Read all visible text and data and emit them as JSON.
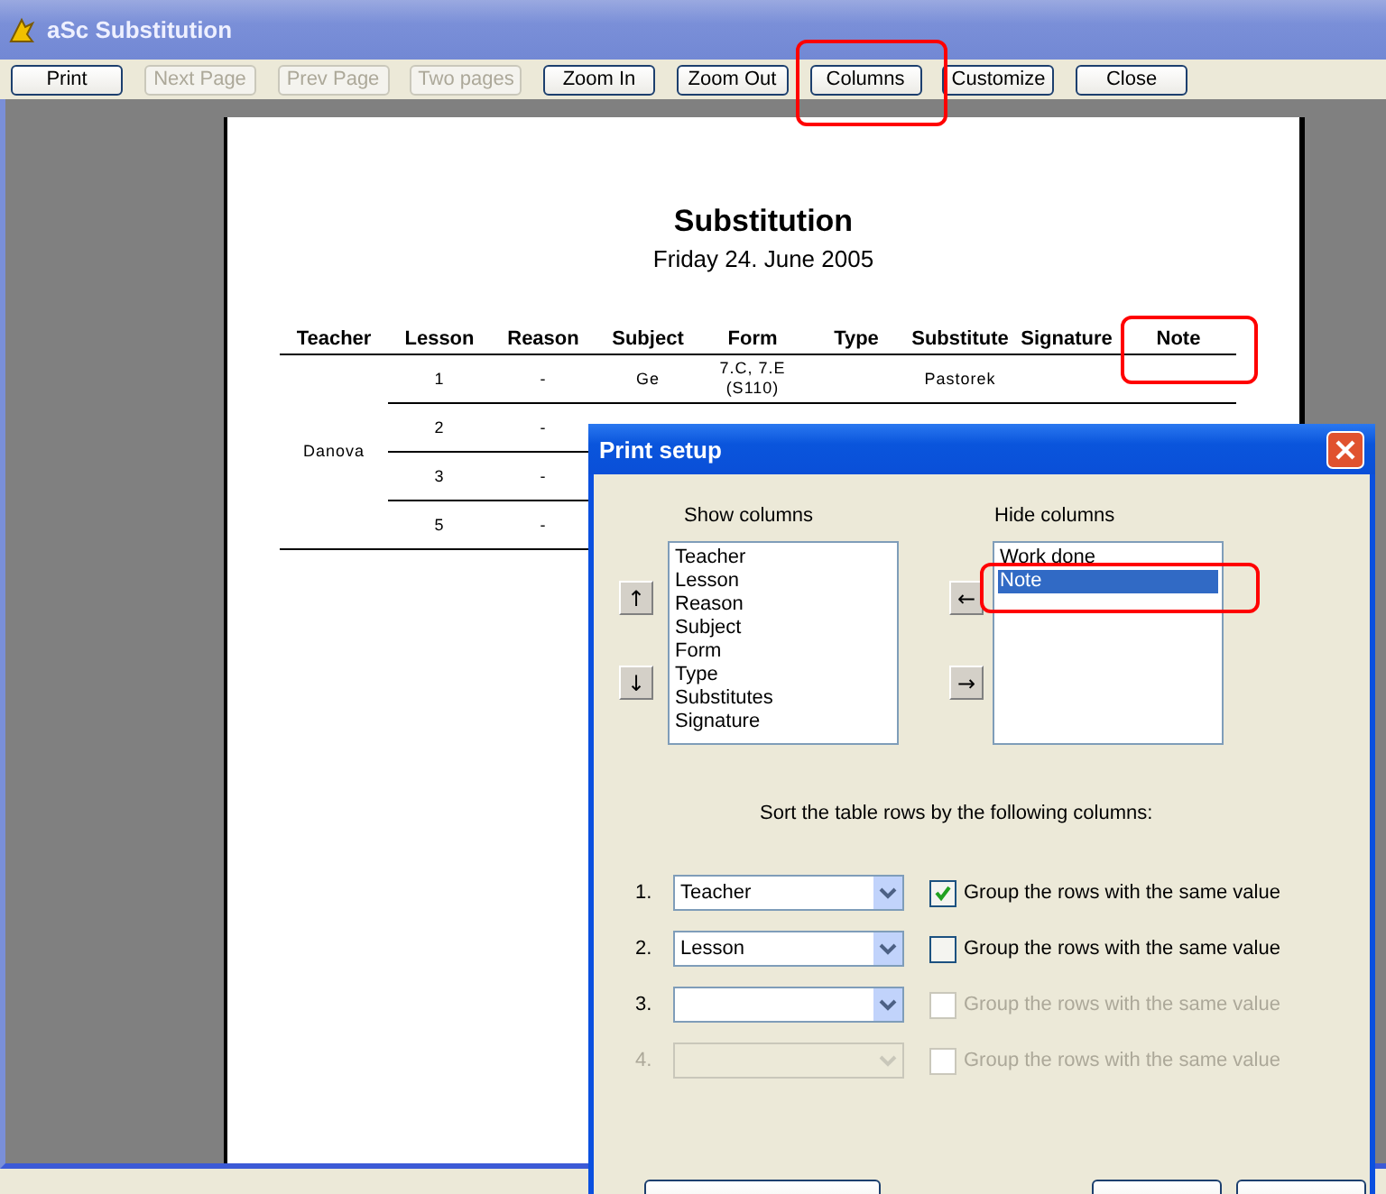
{
  "window": {
    "title": "aSc Substitution"
  },
  "toolbar": [
    {
      "label": "Print",
      "disabled": false
    },
    {
      "label": "Next Page",
      "disabled": true
    },
    {
      "label": "Prev Page",
      "disabled": true
    },
    {
      "label": "Two pages",
      "disabled": true
    },
    {
      "label": "Zoom In",
      "disabled": false
    },
    {
      "label": "Zoom Out",
      "disabled": false
    },
    {
      "label": "Columns",
      "disabled": false
    },
    {
      "label": "Customize",
      "disabled": false
    },
    {
      "label": "Close",
      "disabled": false
    }
  ],
  "report": {
    "title": "Substitution",
    "date": "Friday 24. June 2005",
    "columns": [
      "Teacher",
      "Lesson",
      "Reason",
      "Subject",
      "Form",
      "Type",
      "Substitute",
      "Signature",
      "Note"
    ],
    "groups": [
      {
        "teacher": "Danova",
        "rows": [
          {
            "lesson": "1",
            "reason": "-",
            "subject": "Ge",
            "form": "7.C, 7.E (S110)",
            "substitutes": "Pastorek"
          },
          {
            "lesson": "2",
            "reason": "-"
          },
          {
            "lesson": "3",
            "reason": "-"
          },
          {
            "lesson": "5",
            "reason": "-"
          }
        ]
      }
    ]
  },
  "dialog": {
    "title": "Print setup",
    "show_label": "Show columns",
    "hide_label": "Hide columns",
    "show_columns": [
      {
        "label": "Teacher",
        "selected": false
      },
      {
        "label": "Lesson",
        "selected": false
      },
      {
        "label": "Reason",
        "selected": false
      },
      {
        "label": "Subject",
        "selected": false
      },
      {
        "label": "Form",
        "selected": false
      },
      {
        "label": "Type",
        "selected": false
      },
      {
        "label": "Substitutes",
        "selected": false
      },
      {
        "label": "Signature",
        "selected": false
      }
    ],
    "hide_columns": [
      {
        "label": "Work done",
        "selected": false
      },
      {
        "label": "Note",
        "selected": true
      }
    ],
    "order_buttons": [
      "↑",
      "↓"
    ],
    "move_buttons": [
      "←",
      "→"
    ],
    "sort_caption": "Sort the table rows by the following columns:",
    "sort_rows": [
      {
        "number": "1.",
        "value": "Teacher",
        "disabled": false,
        "checked": true,
        "checkbox_disabled": false,
        "label": "Group the rows with the same value"
      },
      {
        "number": "2.",
        "value": "Lesson",
        "disabled": false,
        "checked": false,
        "checkbox_disabled": false,
        "label": "Group the rows with the same value"
      },
      {
        "number": "3.",
        "disabled": false,
        "checked": false,
        "checkbox_disabled": true,
        "label": "Group the rows with the same value"
      },
      {
        "number": "4.",
        "disabled": true,
        "checked": false,
        "checkbox_disabled": true,
        "label": "Group the rows with the same value"
      }
    ]
  }
}
